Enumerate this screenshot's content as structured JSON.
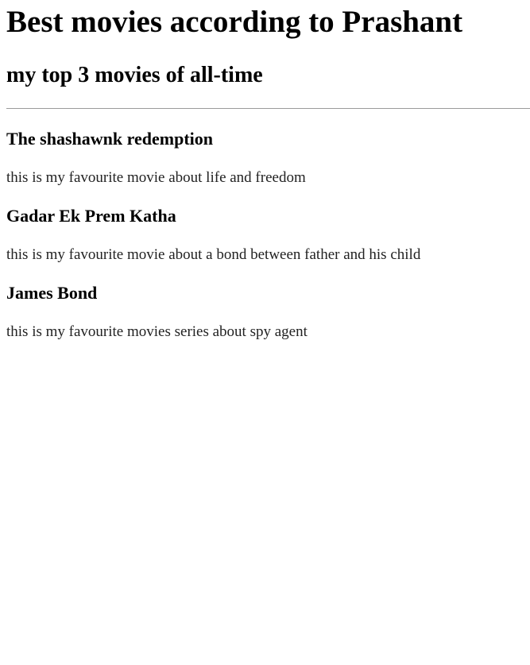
{
  "page": {
    "title": "Best movies according to Prashant",
    "subtitle": "my top 3 movies of all-time"
  },
  "movies": [
    {
      "title": "The shashawnk redemption",
      "description": "this is my favourite movie about life and freedom"
    },
    {
      "title": "Gadar Ek Prem Katha",
      "description": "this is my favourite movie about a bond between father and his child"
    },
    {
      "title": "James Bond",
      "description": "this is my favourite movies series about spy agent"
    }
  ]
}
